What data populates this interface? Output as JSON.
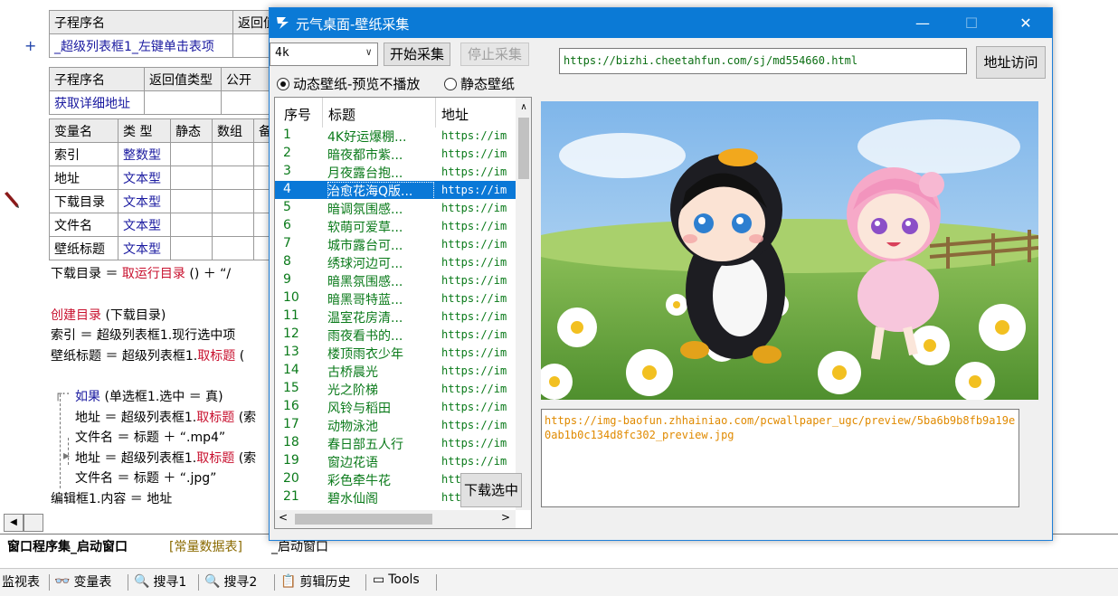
{
  "ide": {
    "sub1_headers": [
      "子程序名",
      "返回值"
    ],
    "sub1_name": "_超级列表框1_左键单击表项",
    "sub2_headers": [
      "子程序名",
      "返回值类型",
      "公开"
    ],
    "sub2_name": "获取详细地址",
    "var_headers": [
      "变量名",
      "类 型",
      "静态",
      "数组",
      "备"
    ],
    "vars": [
      {
        "name": "索引",
        "type": "整数型"
      },
      {
        "name": "地址",
        "type": "文本型"
      },
      {
        "name": "下载目录",
        "type": "文本型"
      },
      {
        "name": "文件名",
        "type": "文本型"
      },
      {
        "name": "壁纸标题",
        "type": "文本型"
      }
    ],
    "code": {
      "l1a": "下载目录 ＝ ",
      "l1b": "取运行目录",
      "l1c": " () ＋ “/",
      "l2a": "创建目录",
      "l2b": " (下载目录)",
      "l3": "索引 ＝ 超级列表框1.现行选中项",
      "l4a": "壁纸标题 ＝ 超级列表框1.",
      "l4b": "取标题",
      "l4c": " (",
      "l5a": "如果",
      "l5b": " (单选框1.选中 ＝ 真)",
      "l6a": "地址 ＝ 超级列表框1.",
      "l6b": "取标题",
      "l6c": " (索",
      "l7": "文件名 ＝ 标题 ＋ “.mp4”",
      "l8a": "地址 ＝ 超级列表框1.",
      "l8b": "取标题",
      "l8c": " (索",
      "l9": "文件名 ＝ 标题 ＋ “.jpg”",
      "l10": "编辑框1.内容 ＝ 地址"
    },
    "tabs": [
      "窗口程序集_启动窗口",
      "[常量数据表]",
      "_启动窗口"
    ],
    "bottom_items": [
      "监视表",
      "变量表",
      "搜寻1",
      "搜寻2",
      "剪辑历史",
      "Tools"
    ]
  },
  "window": {
    "title": "元气桌面-壁纸采集",
    "minimize": "—",
    "maximize": "☐",
    "close": "✕",
    "resolution": "4k",
    "start_button": "开始采集",
    "stop_button": "停止采集",
    "radio_dynamic": "动态壁纸-预览不播放",
    "radio_static": "静态壁纸",
    "url": "https://bizhi.cheetahfun.com/sj/md554660.html",
    "visit_button": "地址访问",
    "list_headers": [
      "序号",
      "标题",
      "地址"
    ],
    "selected_index": 3,
    "rows": [
      {
        "no": "1",
        "title": "4K好运爆棚...",
        "url": "https://im"
      },
      {
        "no": "2",
        "title": "暗夜都市紫...",
        "url": "https://im"
      },
      {
        "no": "3",
        "title": "月夜露台抱...",
        "url": "https://im"
      },
      {
        "no": "4",
        "title": "治愈花海Q版...",
        "url": "https://im"
      },
      {
        "no": "5",
        "title": "暗调氛围感...",
        "url": "https://im"
      },
      {
        "no": "6",
        "title": "软萌可爱草...",
        "url": "https://im"
      },
      {
        "no": "7",
        "title": "城市露台可...",
        "url": "https://im"
      },
      {
        "no": "8",
        "title": "绣球河边可...",
        "url": "https://im"
      },
      {
        "no": "9",
        "title": "暗黑氛围感...",
        "url": "https://im"
      },
      {
        "no": "10",
        "title": "暗黑哥特蓝...",
        "url": "https://im"
      },
      {
        "no": "11",
        "title": "温室花房清...",
        "url": "https://im"
      },
      {
        "no": "12",
        "title": "雨夜看书的...",
        "url": "https://im"
      },
      {
        "no": "13",
        "title": "楼顶雨衣少年",
        "url": "https://im"
      },
      {
        "no": "14",
        "title": "古桥晨光",
        "url": "https://im"
      },
      {
        "no": "15",
        "title": "光之阶梯",
        "url": "https://im"
      },
      {
        "no": "16",
        "title": "风铃与稻田",
        "url": "https://im"
      },
      {
        "no": "17",
        "title": "动物泳池",
        "url": "https://im"
      },
      {
        "no": "18",
        "title": "春日部五人行",
        "url": "https://im"
      },
      {
        "no": "19",
        "title": "窗边花语",
        "url": "https://im"
      },
      {
        "no": "20",
        "title": "彩色牵牛花",
        "url": "htt"
      },
      {
        "no": "21",
        "title": "碧水仙阁",
        "url": "htt"
      }
    ],
    "download_button": "下载选中",
    "info_text": "https://img-baofun.zhhainiao.com/pcwallpaper_ugc/preview/5ba6b9b8fb9a19e0ab1b0c134d8fc302_preview.jpg",
    "colors": {
      "titlebar": "#0b7ad6",
      "selection": "#0a78d7",
      "list_text": "#0a7a1a",
      "info_text": "#e08a00"
    }
  }
}
